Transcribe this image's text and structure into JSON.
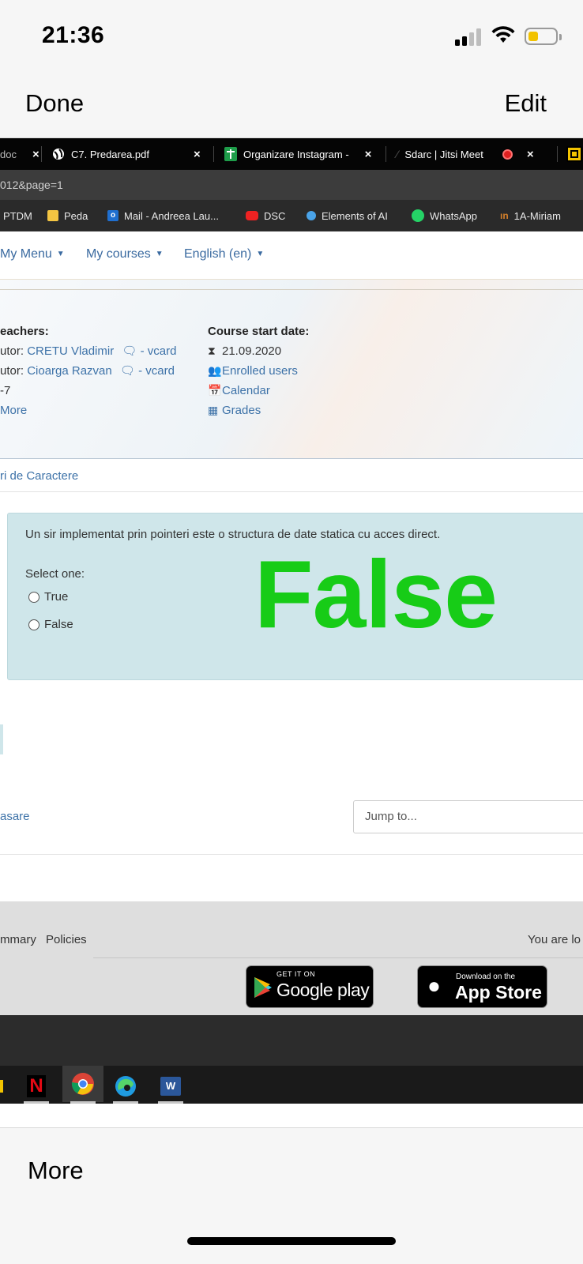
{
  "status": {
    "time": "21:36"
  },
  "nav": {
    "done": "Done",
    "edit": "Edit"
  },
  "browser": {
    "tabs": [
      {
        "label": "doc",
        "close": "×"
      },
      {
        "label": "C7. Predarea.pdf",
        "close": "×"
      },
      {
        "label": "Organizare Instagram -",
        "close": "×"
      },
      {
        "label": "Sdarc | Jitsi Meet",
        "close": "×"
      }
    ],
    "url": "012&page=1",
    "bookmarks": [
      "PTDM",
      "Peda",
      "Mail - Andreea Lau...",
      "DSC",
      "Elements of AI",
      "WhatsApp",
      "1A-Miriam"
    ]
  },
  "menu": {
    "items": [
      "My Menu",
      "My courses",
      "English (en)"
    ]
  },
  "course": {
    "teachers_heading": "eachers:",
    "teachers": [
      {
        "prefix": "utor:",
        "name": "CRETU Vladimir",
        "vcard": "- vcard"
      },
      {
        "prefix": "utor:",
        "name": "Cioarga Razvan",
        "vcard": "- vcard"
      }
    ],
    "extra": "-7",
    "more": "More",
    "start_heading": "Course start date:",
    "start_date": "21.09.2020",
    "links": [
      "Enrolled users",
      "Calendar",
      "Grades"
    ]
  },
  "breadcrumb": "ri de Caractere",
  "question": {
    "text": "Un sir implementat prin pointeri este o structura de date statica cu acces direct.",
    "select_label": "Select one:",
    "options": [
      "True",
      "False"
    ],
    "answer_overlay": "False",
    "answer_color": "#17cc17"
  },
  "navigation": {
    "prev": "asare",
    "jump": "Jump to..."
  },
  "footer": {
    "links": [
      "mmary",
      "Policies"
    ],
    "right": "You are lo",
    "google": {
      "top": "GET IT ON",
      "main": "Google play"
    },
    "apple": {
      "top": "Download on the",
      "main": "App Store"
    }
  },
  "taskbar": {
    "icons": [
      "netflix-icon",
      "chrome-icon",
      "edge-icon",
      "word-icon"
    ]
  },
  "bottom": {
    "more": "More"
  }
}
